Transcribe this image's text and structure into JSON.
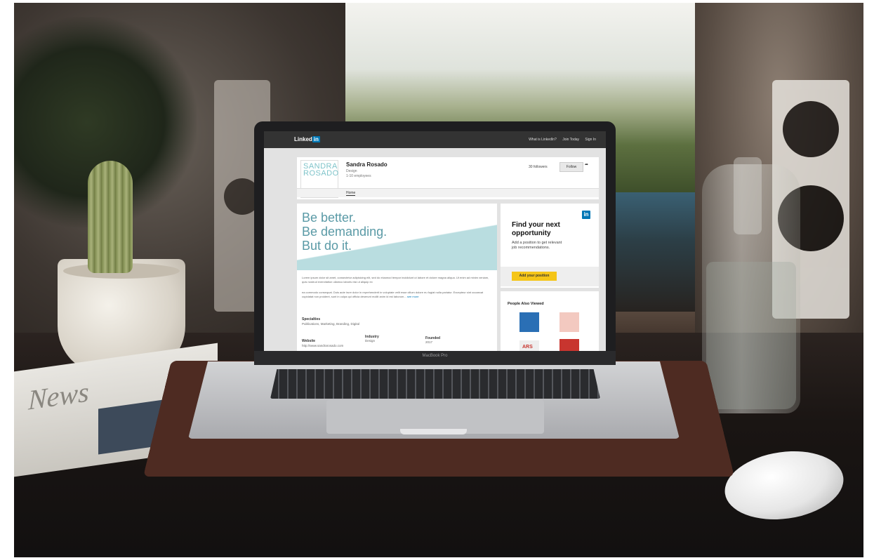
{
  "linkedin": {
    "logo_text": "Linked",
    "logo_in": "in",
    "nav": [
      "What is LinkedIn?",
      "Join Today",
      "Sign In"
    ]
  },
  "company": {
    "logo_line1": "SANDRA",
    "logo_line2": "ROSADO",
    "name": "Sandra Rosado",
    "industry": "Design",
    "employees": "1-10 employees",
    "followers": "30 followers",
    "follow_label": "Follow",
    "tab_home": "Home"
  },
  "banner": {
    "line1": "Be better.",
    "line2": "Be demanding.",
    "line3": "But do it."
  },
  "about": {
    "para1": "Lorem ipsum dolor sit amet, consectetur adipisicing elit, sed do eiusmod tempor incididunt ut labore et dolore magna aliqua. Ut enim ad minim veniam, quis nostrud exercitation ullamco laboris nisi ut aliquip ex",
    "para2": "ea commodo consequat. Duis aute irure dolor in reprehenderit in voluptate velit esse cillum dolore eu fugiat nulla pariatur. Excepteur sint occaecat cupidatat non proident, sunt in culpa qui officia deserunt mollit anim id est laborum...",
    "see_more": "see more"
  },
  "details": {
    "specialties_label": "Specialties",
    "specialties_value": "Publications, Marketing, Branding, Digital",
    "website_label": "Website",
    "website_value": "http://www.sandrarosado.com",
    "industry_label": "Industry",
    "industry_value": "Design",
    "founded_label": "Founded",
    "founded_value": "2017"
  },
  "sidebar": {
    "badge": "in",
    "title": "Find your next opportunity",
    "description": "Add a position to get relevant job recommendations.",
    "button": "Add your position",
    "people_heading": "People Also Viewed"
  },
  "laptop_label": "MacBook Pro",
  "newspaper_word": "News"
}
